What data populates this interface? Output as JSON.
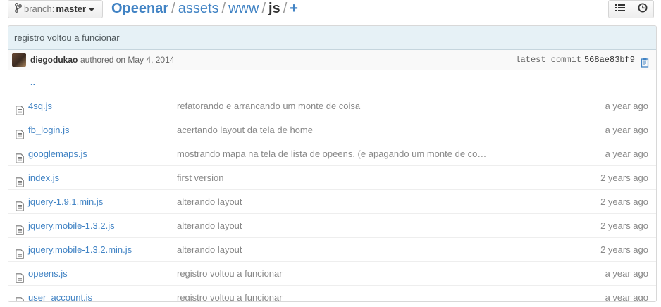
{
  "branch": {
    "label": "branch:",
    "name": "master"
  },
  "breadcrumb": {
    "repo": "Opeenar",
    "parts": [
      "assets",
      "www"
    ],
    "current": "js",
    "add": "+"
  },
  "toolbar": {
    "list_icon": "list-icon",
    "history_icon": "history-icon"
  },
  "commit": {
    "message": "registro voltou a funcionar",
    "author": "diegodukao",
    "authored": "authored on May 4, 2014",
    "latest_label": "latest commit",
    "sha": "568ae83bf9",
    "clipboard_icon": "clipboard-icon"
  },
  "files": [
    {
      "name": "..",
      "message": "",
      "age": ""
    },
    {
      "name": "4sq.js",
      "message": "refatorando e arrancando um monte de coisa",
      "age": "a year ago"
    },
    {
      "name": "fb_login.js",
      "message": "acertando layout da tela de home",
      "age": "a year ago"
    },
    {
      "name": "googlemaps.js",
      "message": "mostrando mapa na tela de lista de opeens. (e apagando um monte de co…",
      "age": "a year ago"
    },
    {
      "name": "index.js",
      "message": "first version",
      "age": "2 years ago"
    },
    {
      "name": "jquery-1.9.1.min.js",
      "message": "alterando layout",
      "age": "2 years ago"
    },
    {
      "name": "jquery.mobile-1.3.2.js",
      "message": "alterando layout",
      "age": "2 years ago"
    },
    {
      "name": "jquery.mobile-1.3.2.min.js",
      "message": "alterando layout",
      "age": "2 years ago"
    },
    {
      "name": "opeens.js",
      "message": "registro voltou a funcionar",
      "age": "a year ago"
    },
    {
      "name": "user_account.js",
      "message": "registro voltou a funcionar",
      "age": "a year ago"
    }
  ],
  "colors": {
    "link": "#4183c4",
    "commit_bg": "#e6f1f6",
    "muted": "#888888"
  }
}
